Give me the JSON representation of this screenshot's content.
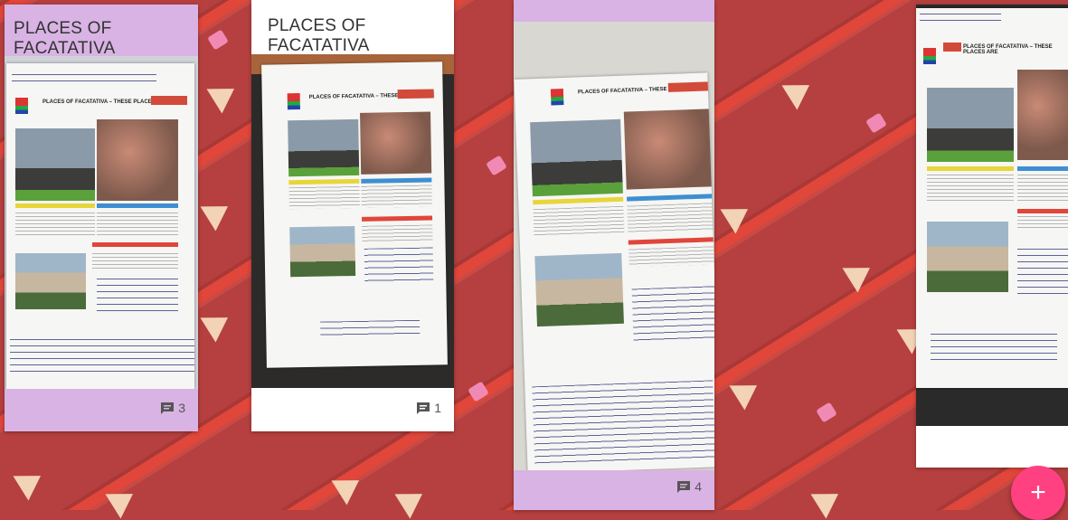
{
  "board": {
    "background": "pencil-pattern",
    "accent": "#ff4081",
    "card_purple": "#d9b3e4"
  },
  "cards": [
    {
      "title": "PLACES OF FACATATIVA",
      "comments": "3",
      "color": "#d9b3e4"
    },
    {
      "title": "PLACES OF FACATATIVA",
      "comments": "1",
      "color": "#ffffff"
    },
    {
      "title": "",
      "comments": "4",
      "color": "#d9b3e4"
    },
    {
      "title": "",
      "comments": "",
      "color": "#ffffff"
    }
  ],
  "fab": {
    "label": "+",
    "icon": "plus-icon"
  }
}
